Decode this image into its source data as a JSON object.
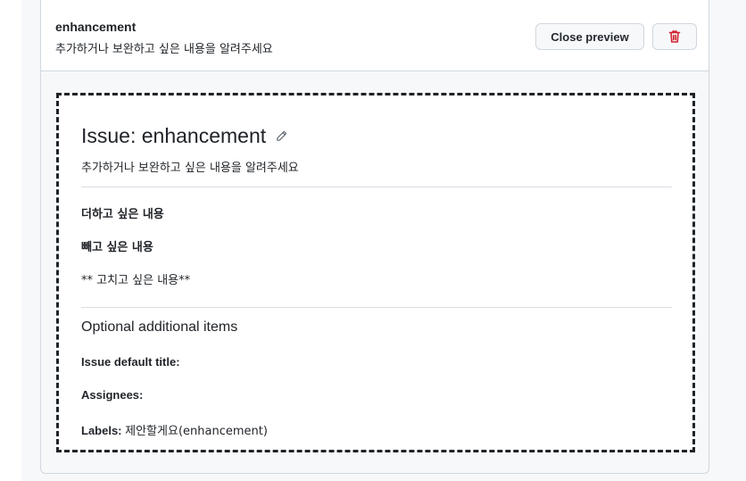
{
  "header": {
    "template_name": "enhancement",
    "template_description": "추가하거나 보완하고 싶은 내용을 알려주세요",
    "close_preview_label": "Close preview"
  },
  "preview": {
    "title": "Issue: enhancement",
    "description": "추가하거나 보완하고 싶은 내용을 알려주세요",
    "body": {
      "line1": "더하고 싶은 내용",
      "line2": "빼고 싶은 내용",
      "line3": "** 고치고 싶은 내용**"
    },
    "optional": {
      "heading": "Optional additional items",
      "default_title_label": "Issue default title:",
      "default_title_value": "",
      "assignees_label": "Assignees:",
      "assignees_value": "",
      "labels_label": "Labels:",
      "labels_value": "제안할게요(enhancement)"
    }
  },
  "icons": {
    "edit": "pencil-icon",
    "delete": "trash-icon"
  },
  "colors": {
    "danger": "#cf222e",
    "border": "#d0d7de",
    "text": "#1f2328"
  }
}
